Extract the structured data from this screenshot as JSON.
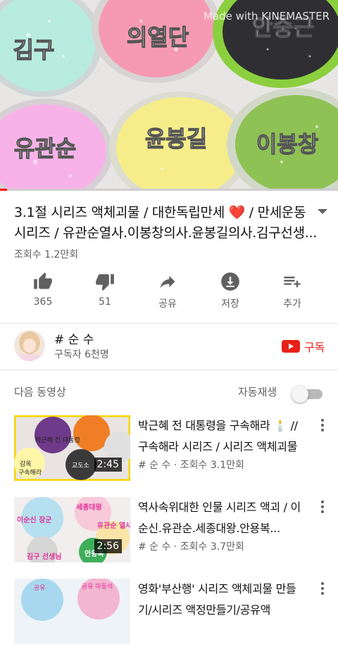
{
  "player": {
    "watermark": "Made with KINEMASTER",
    "jar_labels": [
      "김구",
      "의열단",
      "안중근",
      "유관순",
      "윤봉길",
      "이봉창"
    ],
    "progress": 0.02,
    "progress_color": "#ff0000"
  },
  "video": {
    "title": "3.1절 시리즈 액체괴물 / 대한독립만세 ❤️ / 만세운동 시리즈 / 유관순열사.이봉창의사.윤봉길의사.김구선생...",
    "views": "조회수 1.2만회"
  },
  "actions": [
    {
      "icon": "like-icon",
      "label": "365"
    },
    {
      "icon": "dislike-icon",
      "label": "51"
    },
    {
      "icon": "share-icon",
      "label": "공유"
    },
    {
      "icon": "download-icon",
      "label": "저장"
    },
    {
      "icon": "add-to-playlist-icon",
      "label": "추가"
    }
  ],
  "channel": {
    "name": "# 순 수",
    "subscribers": "구독자 6천명",
    "subscribe_label": "구독",
    "subscribe_color": "#e62117"
  },
  "up_next": {
    "title": "다음 동영상",
    "autoplay_label": "자동재생",
    "autoplay_on": false
  },
  "videos": [
    {
      "title": "박근혜 전 대통령을 구속해라 🕯️ // 구속해라 시리즈 /  시리즈 액체괴물",
      "meta": "# 순 수 · 조회수 3.1만회",
      "duration": "2:45",
      "thumb_labels": [
        "박근혜 전 대통령",
        "교도소",
        "감옥",
        "구속해라"
      ]
    },
    {
      "title": "역사속위대한 인물 시리즈 액괴 / 이순신.유관순.세종대왕.안용복...",
      "meta": "# 순 수 · 조회수 3.7만회",
      "duration": "2:56",
      "thumb_labels": [
        "이순신 장군",
        "세종대왕",
        "유관순 열사",
        "김구 선생님",
        "안용복"
      ]
    },
    {
      "title": "영화'부산행' 시리즈 액체괴물 만들기/시리즈 액정만들기/공유액",
      "meta": "",
      "duration": "",
      "thumb_labels": [
        "공유",
        "공유 마동석"
      ]
    }
  ]
}
